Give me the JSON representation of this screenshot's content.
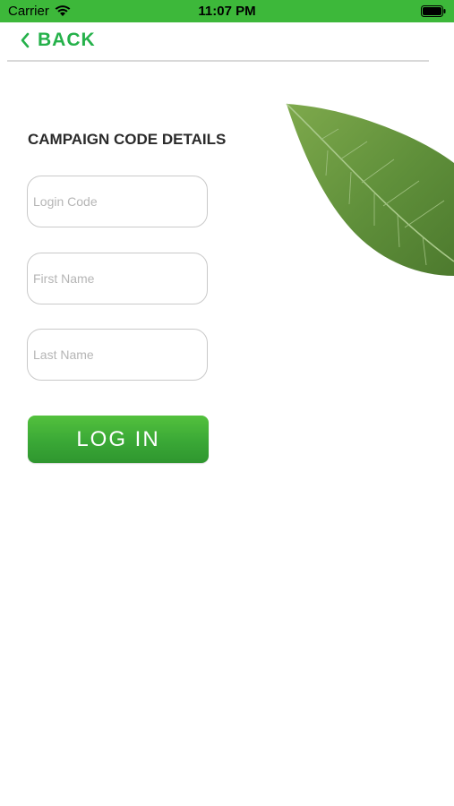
{
  "status_bar": {
    "carrier": "Carrier",
    "time": "11:07 PM",
    "wifi_icon": "wifi-icon",
    "battery_icon": "battery-icon"
  },
  "nav": {
    "back_label": "BACK",
    "back_icon": "chevron-left-icon"
  },
  "form": {
    "title": "CAMPAIGN CODE DETAILS",
    "login_code": {
      "value": "",
      "placeholder": "Login Code"
    },
    "first_name": {
      "value": "",
      "placeholder": "First Name"
    },
    "last_name": {
      "value": "",
      "placeholder": "Last Name"
    },
    "submit_label": "LOG IN"
  },
  "colors": {
    "status_bar": "#3db83a",
    "accent": "#25b14a",
    "button": "#3aa836",
    "leaf": "#5f8f3a"
  }
}
